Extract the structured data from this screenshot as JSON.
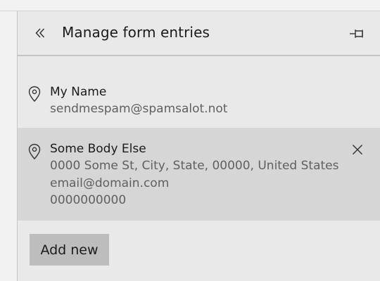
{
  "panel": {
    "title": "Manage form entries",
    "back_icon": "double-chevron-left-icon",
    "pin_icon": "pin-icon"
  },
  "entries": [
    {
      "icon": "location-pin-icon",
      "name": "My Name",
      "details": [
        "sendmespam@spamsalot.not"
      ],
      "selected": false
    },
    {
      "icon": "location-pin-icon",
      "name": "Some Body Else",
      "details": [
        "0000 Some St, City, State, 00000, United States",
        "email@domain.com",
        "0000000000"
      ],
      "selected": true,
      "remove_icon": "close-icon"
    }
  ],
  "actions": {
    "add_new_label": "Add new"
  },
  "colors": {
    "panel_bg": "#e9e9e9",
    "selected_bg": "#d6d6d6",
    "button_bg": "#bdbdbd",
    "secondary_text": "#606060"
  }
}
